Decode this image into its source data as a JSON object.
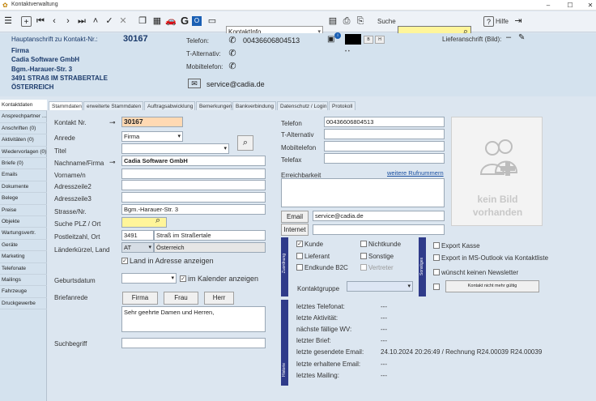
{
  "window": {
    "title": "Kontaktverwaltung"
  },
  "toolbar": {
    "kontakt_combo": "KontaktInfo",
    "search_label": "Suche",
    "help_label": "Hilfe",
    "search_value": ""
  },
  "header": {
    "hauptanschrift_label": "Hauptanschrift zu Kontakt-Nr.:",
    "kontakt_nr": "30167",
    "line1": "Firma",
    "line2": "Cadia Software GmbH",
    "line3": "Bgm.-Harauer-Str. 3",
    "line4": "3491 STRAß IM STRABERTALE",
    "line5": "ÖSTERREICH",
    "telefon_label": "Telefon:",
    "telefon_value": "00436606804513",
    "t_alt_label": "T-Alternativ:",
    "mobil_label": "Mobiltelefon:",
    "email_value": "service@cadia.de",
    "lieferanschrift_label": "Lieferanschrift (Bild):",
    "mini_b": "B",
    "mini_h": "H",
    "dots": "• •"
  },
  "tabs": [
    {
      "label": "Stammdaten"
    },
    {
      "label": "erweiterte Stammdaten"
    },
    {
      "label": "Auftragsabwicklung"
    },
    {
      "label": "Bemerkungen"
    },
    {
      "label": "Bankverbindung"
    },
    {
      "label": "Datenschutz / Login"
    },
    {
      "label": "Protokoll"
    }
  ],
  "sidebar": [
    {
      "label": "Kontaktdaten"
    },
    {
      "label": "Ansprechpartner ..."
    },
    {
      "label": "Anschriften (0)"
    },
    {
      "label": "Aktivitäten (0)"
    },
    {
      "label": "Wiedervorlagen (0)"
    },
    {
      "label": "Briefe (0)"
    },
    {
      "label": "Emails"
    },
    {
      "label": "Dokumente"
    },
    {
      "label": "Belege"
    },
    {
      "label": "Preise"
    },
    {
      "label": "Objekte"
    },
    {
      "label": "Wartungsvertr."
    },
    {
      "label": "Geräte"
    },
    {
      "label": "Marketing"
    },
    {
      "label": "Telefonate"
    },
    {
      "label": "Mailings"
    },
    {
      "label": "Fahrzeuge"
    },
    {
      "label": "Druckgewerbe"
    }
  ],
  "form": {
    "kontakt_nr_label": "Kontakt Nr.",
    "kontakt_nr": "30167",
    "anrede_label": "Anrede",
    "anrede": "Firma",
    "titel_label": "Titel",
    "titel": "",
    "name_label": "Nachname/Firma",
    "name": "Cadia Software GmbH",
    "vorname_label": "Vorname/n",
    "vorname": "",
    "adr2_label": "Adresszeile2",
    "adr2": "",
    "adr3_label": "Adresszeile3",
    "adr3": "",
    "strasse_label": "Strasse/Nr.",
    "strasse": "Bgm.-Harauer-Str. 3",
    "plz_search_label": "Suche PLZ / Ort",
    "plz_search": "",
    "plz_label": "Postleitzahl, Ort",
    "plz": "3491",
    "ort": "Straß im Straßertale",
    "land_label": "Länderkürzel, Land",
    "land_code": "AT",
    "land": "Österreich",
    "land_in_adresse": "Land in Adresse anzeigen",
    "geburt_label": "Geburtsdatum",
    "geburt": "",
    "kalender": "im Kalender anzeigen",
    "briefanrede_label": "Briefanrede",
    "btn_firma": "Firma",
    "btn_frau": "Frau",
    "btn_herr": "Herr",
    "briefanrede": "Sehr geehrte Damen und Herren,",
    "suchbegriff_label": "Suchbegriff",
    "suchbegriff": ""
  },
  "contact": {
    "telefon_label": "Telefon",
    "telefon": "00436606804513",
    "t_alt_label": "T-Alternativ",
    "t_alt": "",
    "mobil_label": "Mobiltelefon",
    "mobil": "",
    "telefax_label": "Telefax",
    "telefax": "",
    "erreich_label": "Erreichbarkeit",
    "weitere": "weitere Rufnummern",
    "email_btn": "Email",
    "email": "service@cadia.de",
    "internet_btn": "Internet",
    "internet": ""
  },
  "image": {
    "line1": "kein Bild",
    "line2": "vorhanden"
  },
  "zuordnung": {
    "bar": "Zuordnung",
    "kunde": "Kunde",
    "nichtkunde": "Nichtkunde",
    "lieferant": "Lieferant",
    "sonstige": "Sonstige",
    "endkunde": "Endkunde B2C",
    "vertreter": "Vertreter",
    "kontaktgruppe_label": "Kontaktgruppe",
    "kontaktgruppe": ""
  },
  "sonstiges": {
    "bar": "Sonstiges",
    "export_kasse": "Export Kasse",
    "export_outlook": "Export in MS-Outlook via Kontaktliste",
    "newsletter": "wünscht keinen Newsletter",
    "nicht_gueltig": "Kontakt nicht mehr gültig"
  },
  "historie": {
    "bar": "Historie",
    "rows": [
      {
        "label": "letztes Telefonat:",
        "value": "---"
      },
      {
        "label": "letzte Aktivität:",
        "value": "---"
      },
      {
        "label": "nächste fällige WV:",
        "value": "---"
      },
      {
        "label": "letzter Brief:",
        "value": "---"
      },
      {
        "label": "letzte gesendete Email:",
        "value": "24.10.2024 20:26:49 / Rechnung R24.00039 R24.00039"
      },
      {
        "label": "letzte erhaltene Email:",
        "value": "---"
      },
      {
        "label": "letztes Mailing:",
        "value": "---"
      }
    ]
  },
  "colors": {
    "highlight": "#ffd9b3",
    "search_yellow": "#fff59a",
    "bar_blue": "#2f3b8a"
  }
}
